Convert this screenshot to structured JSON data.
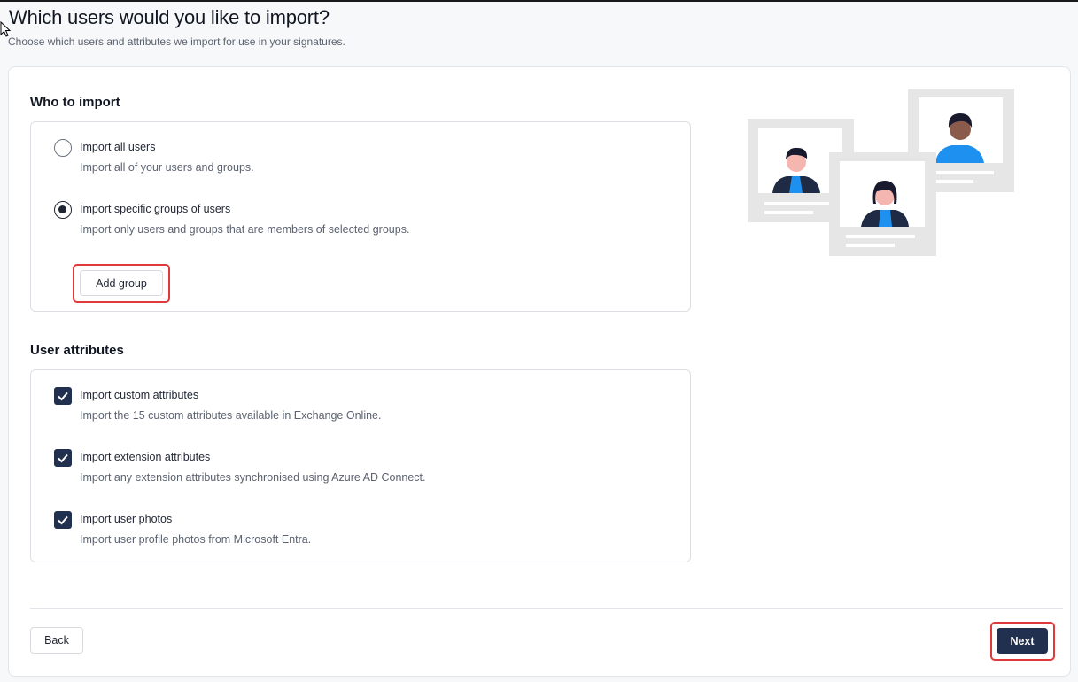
{
  "header": {
    "title": "Which users would you like to import?",
    "subtitle": "Choose which users and attributes we import for use in your signatures."
  },
  "who_to_import": {
    "title": "Who to import",
    "options": [
      {
        "label": "Import all users",
        "description": "Import all of your users and groups.",
        "selected": false
      },
      {
        "label": "Import specific groups of users",
        "description": "Import only users and groups that are members of selected groups.",
        "selected": true
      }
    ],
    "add_group_label": "Add group"
  },
  "user_attributes": {
    "title": "User attributes",
    "options": [
      {
        "label": "Import custom attributes",
        "description": "Import the 15 custom attributes available in Exchange Online.",
        "checked": true
      },
      {
        "label": "Import extension attributes",
        "description": "Import any extension attributes synchronised using Azure AD Connect.",
        "checked": true
      },
      {
        "label": "Import user photos",
        "description": "Import user profile photos from Microsoft Entra.",
        "checked": true
      }
    ]
  },
  "footer": {
    "back_label": "Back",
    "next_label": "Next"
  },
  "colors": {
    "primary": "#22304f",
    "highlight": "#e0393b",
    "accent_blue": "#1e90f0"
  },
  "icons": [
    "mouse-pointer-icon",
    "radio-unchecked-icon",
    "radio-checked-icon",
    "checkmark-icon",
    "users-illustration"
  ]
}
